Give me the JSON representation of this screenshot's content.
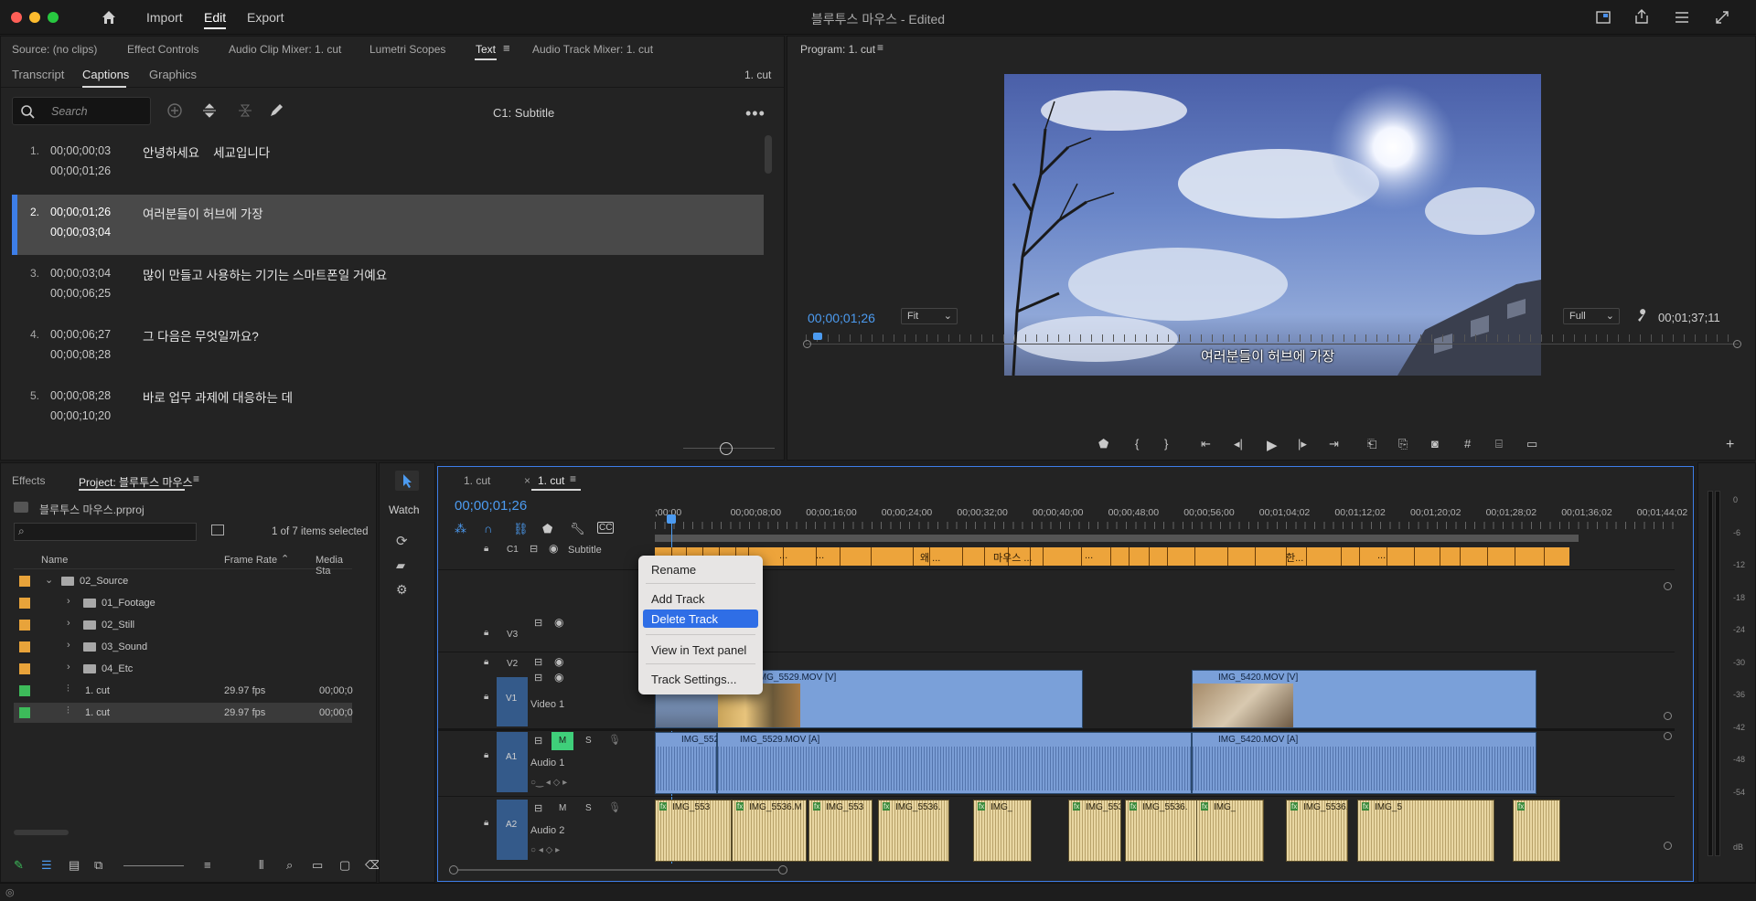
{
  "titlebar": {
    "menu": [
      "Import",
      "Edit",
      "Export"
    ],
    "title": "블루투스 마우스 - Edited"
  },
  "source_panel": {
    "tabs": [
      "Source: (no clips)",
      "Effect Controls",
      "Audio Clip Mixer: 1. cut",
      "Lumetri Scopes",
      "Text",
      "Audio Track Mixer: 1. cut"
    ],
    "subtabs": [
      "Transcript",
      "Captions",
      "Graphics"
    ],
    "sequence": "1. cut",
    "search_placeholder": "Search",
    "track_label": "C1: Subtitle",
    "captions": [
      {
        "num": "1.",
        "in": "00;00;00;03",
        "out": "00;00;01;26",
        "text": "안녕하세요    세교입니다"
      },
      {
        "num": "2.",
        "in": "00;00;01;26",
        "out": "00;00;03;04",
        "text": "여러분들이 허브에 가장"
      },
      {
        "num": "3.",
        "in": "00;00;03;04",
        "out": "00;00;06;25",
        "text": "많이 만들고 사용하는 기기는 스마트폰일 거예요"
      },
      {
        "num": "4.",
        "in": "00;00;06;27",
        "out": "00;00;08;28",
        "text": "그 다음은 무엇일까요?"
      },
      {
        "num": "5.",
        "in": "00;00;08;28",
        "out": "00;00;10;20",
        "text": "바로 업무 과제에 대응하는 데"
      }
    ]
  },
  "program": {
    "title": "Program: 1. cut",
    "subtitle_overlay": "여러분들이 허브에 가장",
    "timecode": "00;00;01;26",
    "fit": "Fit",
    "quality": "Full",
    "duration": "00;01;37;11"
  },
  "project_panel": {
    "tabs": [
      "Effects",
      "Project: 블루투스 마우스"
    ],
    "file": "블루투스 마우스.prproj",
    "selected_count": "1 of 7 items selected",
    "columns": [
      "Name",
      "Frame Rate",
      "Media Sta"
    ],
    "items": [
      {
        "name": "02_Source",
        "color": "#e8a33a",
        "indent": 0,
        "type": "folder",
        "expanded": true,
        "fps": "",
        "media": ""
      },
      {
        "name": "01_Footage",
        "color": "#e8a33a",
        "indent": 1,
        "type": "folder",
        "fps": "",
        "media": ""
      },
      {
        "name": "02_Still",
        "color": "#e8a33a",
        "indent": 1,
        "type": "folder",
        "fps": "",
        "media": ""
      },
      {
        "name": "03_Sound",
        "color": "#e8a33a",
        "indent": 1,
        "type": "folder",
        "fps": "",
        "media": ""
      },
      {
        "name": "04_Etc",
        "color": "#e8a33a",
        "indent": 1,
        "type": "folder",
        "fps": "",
        "media": ""
      },
      {
        "name": "1. cut",
        "color": "#3dbb5a",
        "indent": 1,
        "type": "sequence",
        "fps": "29.97 fps",
        "media": "00;00;0"
      },
      {
        "name": "1. cut",
        "color": "#3dbb5a",
        "indent": 1,
        "type": "sequence",
        "fps": "29.97 fps",
        "media": "00;00;0",
        "selected": true
      }
    ]
  },
  "tools": {
    "watch": "Watch"
  },
  "timeline": {
    "tabs": [
      "1. cut",
      "1. cut"
    ],
    "timecode": "00;00;01;26",
    "ruler": [
      ";00;00",
      "00;00;08;00",
      "00;00;16;00",
      "00;00;24;00",
      "00;00;32;00",
      "00;00;40;00",
      "00;00;48;00",
      "00;00;56;00",
      "00;01;04;02",
      "00;01;12;02",
      "00;01;20;02",
      "00;01;28;02",
      "00;01;36;02",
      "00;01;44;02"
    ],
    "tracks": {
      "c1": "C1",
      "subtitle": "Subtitle",
      "v3": "V3",
      "v2": "V2",
      "v1": "V1",
      "video1": "Video 1",
      "a1": "A1",
      "audio1": "Audio 1",
      "a2": "A2",
      "audio2": "Audio 2",
      "m": "M",
      "s": "S"
    },
    "sub_labels": [
      "...",
      "...",
      "왜 ...",
      "마우스 ...",
      "...",
      "한...",
      "..."
    ],
    "video_clips": [
      "IMG_5529.MOV [V]",
      "IMG_5420.MOV [V]"
    ],
    "audio_clips": [
      "IMG_552",
      "IMG_5529.MOV [A]",
      "IMG_5420.MOV [A]"
    ],
    "a2_clips": [
      "IMG_553",
      "IMG_5536.M",
      "IMG_553",
      "IMG_5536.",
      "IMG_",
      "IMG_5536.",
      "IMG_5536.",
      "IMG_",
      "IMG_5536.MOV [110%]",
      "IMG_5"
    ],
    "fx": "fx",
    "r": "R"
  },
  "context_menu": {
    "items": [
      "Rename",
      "Add Track",
      "Delete Track",
      "View in Text panel",
      "Track Settings..."
    ],
    "highlighted": "Delete Track"
  },
  "meter": {
    "ticks": [
      "0",
      "-6",
      "-12",
      "-18",
      "-24",
      "-30",
      "-36",
      "-42",
      "-48",
      "-54"
    ],
    "unit": "dB"
  }
}
